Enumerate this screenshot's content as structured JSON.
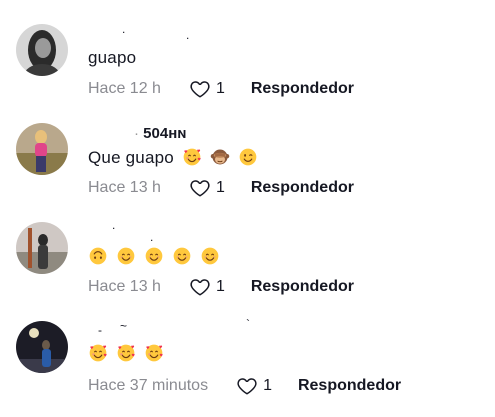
{
  "comments": [
    {
      "username": "",
      "text": "guapo",
      "emojis": [],
      "time": "Hace 12 h",
      "likes": "1",
      "reply_label": "Respondedor"
    },
    {
      "username": "504ʜɴ",
      "text": "Que guapo",
      "emojis": [
        "smiling-face-with-hearts-icon",
        "see-no-evil-monkey-icon",
        "winking-face-icon"
      ],
      "time": "Hace 13 h",
      "likes": "1",
      "reply_label": "Respondedor"
    },
    {
      "username": "",
      "text": "",
      "emojis": [
        "upside-down-face-icon",
        "smiling-face-icon",
        "smiling-face-icon",
        "smiling-face-icon",
        "smiling-face-icon"
      ],
      "time": "Hace 13 h",
      "likes": "1",
      "reply_label": "Respondedor"
    },
    {
      "username": "",
      "text": "",
      "emojis": [
        "smiling-face-with-hearts-icon",
        "smiling-face-with-hearts-icon",
        "smiling-face-with-hearts-icon"
      ],
      "time": "Hace 37 minutos",
      "likes": "1",
      "reply_label": "Respondedor"
    }
  ],
  "colors": {
    "text": "#161823",
    "muted": "#8a8b91",
    "emoji_yellow": "#ffc83d",
    "heart_red": "#f0344c"
  }
}
